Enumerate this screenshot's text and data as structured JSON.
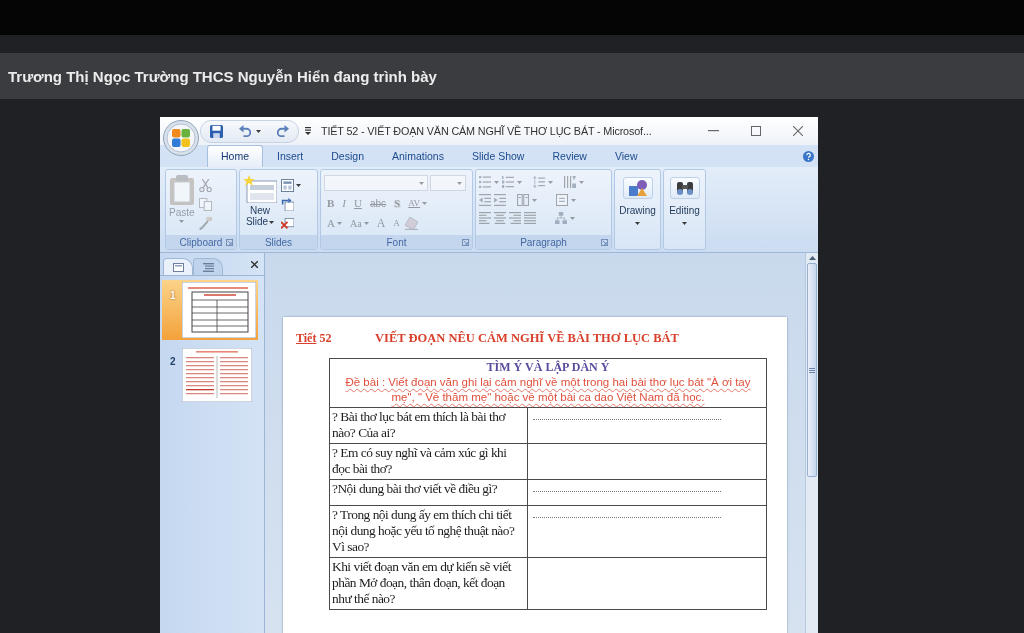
{
  "presenter_bar": {
    "text": "Trương Thị Ngọc Trường THCS Nguyễn Hiển đang trình bày"
  },
  "window": {
    "title": "TIẾT 52 - VIẾT ĐOẠN VĂN CẢM NGHĨ VỀ THƠ LỤC BÁT - Microsof..."
  },
  "tabs": [
    {
      "label": "Home",
      "selected": true
    },
    {
      "label": "Insert",
      "selected": false
    },
    {
      "label": "Design",
      "selected": false
    },
    {
      "label": "Animations",
      "selected": false
    },
    {
      "label": "Slide Show",
      "selected": false
    },
    {
      "label": "Review",
      "selected": false
    },
    {
      "label": "View",
      "selected": false
    }
  ],
  "ribbon": {
    "groups": [
      {
        "kind": "clipboard",
        "label": "Clipboard",
        "disabled": true,
        "button": "Paste"
      },
      {
        "kind": "slides",
        "label": "Slides",
        "disabled": false,
        "button": "New Slide"
      },
      {
        "kind": "font",
        "label": "Font",
        "disabled": true,
        "buttons": [
          [
            {
              "label": "B",
              "kind": "toggle"
            },
            {
              "label": "I",
              "kind": "toggle"
            },
            {
              "label": "U",
              "kind": "toggle"
            },
            {
              "label": "abc",
              "kind": "toggle"
            },
            {
              "label": "S",
              "kind": "toggle"
            },
            {
              "label": "AV",
              "kind": "dropdown"
            }
          ],
          [
            {
              "label": "A",
              "kind": "dropdown"
            },
            {
              "label": "Aa",
              "kind": "dropdown"
            },
            {
              "label": "A",
              "kind": "toggle"
            },
            {
              "label": "A",
              "kind": "toggle"
            }
          ]
        ]
      },
      {
        "kind": "paragraph",
        "label": "Paragraph",
        "disabled": true
      },
      {
        "kind": "drawing",
        "button": "Drawing",
        "disabled": false
      },
      {
        "kind": "editing",
        "button": "Editing",
        "disabled": false
      }
    ]
  },
  "slide_pane": {
    "tabs": [
      {
        "kind": "slides",
        "selected": true
      },
      {
        "kind": "outline",
        "selected": false
      }
    ],
    "thumbnails": [
      {
        "number": "1",
        "selected": true
      },
      {
        "number": "2",
        "selected": false
      }
    ]
  },
  "slide": {
    "lesson_word": "Tiết",
    "lesson_number": "52",
    "title": "VIẾT ĐOẠN NÊU CẢM NGHĨ VỀ BÀI THƠ LỤC BÁT",
    "table": {
      "heading": "TÌM Ý VÀ LẬP DÀN Ý",
      "prompt": "Đề bài :  Viết đoạn văn ghi lại cảm nghĩ về một trong hai bài thơ lục bát \"À ơi tay mẹ\", \" Về thăm mẹ\" hoặc về một bài ca dao Việt Nam đã học.",
      "rows": [
        {
          "question": "? Bài thơ lục bát em thích là bài thơ nào? Của ai?",
          "answer_line": true
        },
        {
          "question": "? Em có suy nghĩ và cảm xúc gì khi đọc bài thơ?",
          "answer_line": false
        },
        {
          "question": "?Nội  dung bài thơ viết về điều gì?",
          "answer_line": true
        },
        {
          "question": "? Trong nội dung ấy em thích chi tiết nội dung hoặc yếu tố nghệ thuật nào? Vì sao?",
          "answer_line": true
        },
        {
          "question": "Khi viết đoạn văn em dự kiến sẽ viết phần Mở đoạn, thân đoạn, kết đoạn như thế nào?",
          "answer_line": false
        }
      ]
    }
  }
}
